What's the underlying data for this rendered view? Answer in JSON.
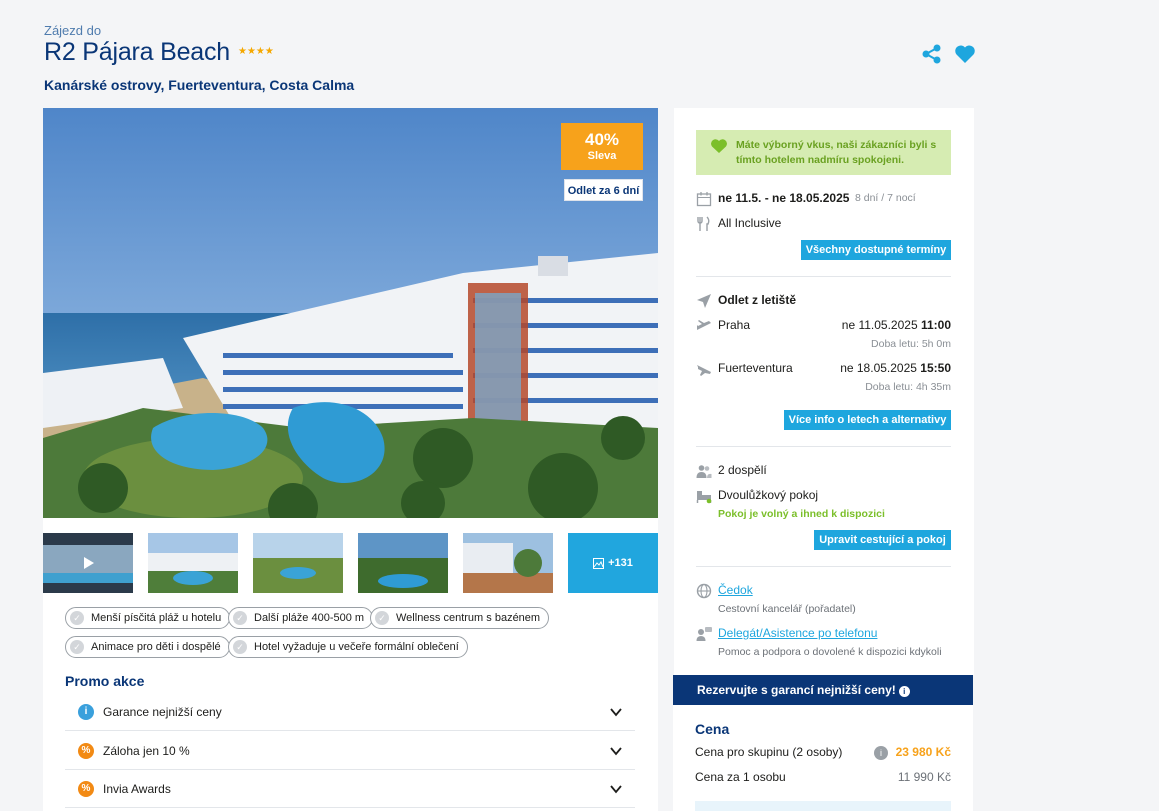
{
  "header": {
    "subtitle": "Zájezd do",
    "title": "R2 Pájara Beach",
    "stars": "★★★★",
    "location": "Kanárské ostrovy, Fuerteventura, Costa Calma"
  },
  "gallery": {
    "discount_pct": "40%",
    "discount_label": "Sleva",
    "departure_badge": "Odlet za 6 dní",
    "more_photos": "+131"
  },
  "tags": [
    "Menší písčitá pláž u hotelu",
    "Další pláže 400-500 m",
    "Wellness centrum s bazénem",
    "Animace pro děti i dospělé",
    "Hotel vyžaduje u večeře formální oblečení"
  ],
  "promo": {
    "title": "Promo akce",
    "items": [
      {
        "label": "Garance nejnižší ceny",
        "icon": "info-icon"
      },
      {
        "label": "Záloha jen 10 %",
        "icon": "percent-icon"
      },
      {
        "label": "Invia Awards",
        "icon": "percent-icon"
      }
    ]
  },
  "booking": {
    "note": "Máte výborný vkus, naši zákazníci byli s tímto hotelem nadmíru spokojeni.",
    "dates": "ne 11.5. - ne 18.05.2025",
    "duration": "8 dní / 7 nocí",
    "board": "All Inclusive",
    "all_dates_button": "Všechny dostupné termíny",
    "departure_airport_label": "Odlet z letiště",
    "outbound_city": "Praha",
    "outbound_date": "ne 11.05.2025",
    "outbound_time": "11:00",
    "outbound_duration": "Doba letu: 5h 0m",
    "return_city": "Fuerteventura",
    "return_date": "ne 18.05.2025",
    "return_time": "15:50",
    "return_duration": "Doba letu: 4h 35m",
    "flights_button": "Více info o letech a alternativy",
    "travelers": "2 dospělí",
    "room": "Dvoulůžkový pokoj",
    "room_status": "Pokoj je volný a ihned k dispozici",
    "edit_button": "Upravit cestující a pokoj",
    "agency_name": "Čedok",
    "agency_desc": "Cestovní kancelář (pořadatel)",
    "support_name": "Delegát/Asistence po telefonu",
    "support_desc": "Pomoc a podpora o dovolené k dispozici kdykoli"
  },
  "pricing": {
    "banner": "Rezervujte s garancí nejnižší ceny!",
    "title": "Cena",
    "group_label": "Cena pro skupinu (2 osoby)",
    "group_price": "23 980 Kč",
    "person_label": "Cena za 1 osobu",
    "person_price": "11 990 Kč"
  },
  "colors": {
    "brand_navy": "#0a3677",
    "accent_blue": "#1ea6de",
    "discount_orange": "#f7a21b",
    "price_orange": "#f7a21b",
    "success_green": "#7bbf2a"
  }
}
